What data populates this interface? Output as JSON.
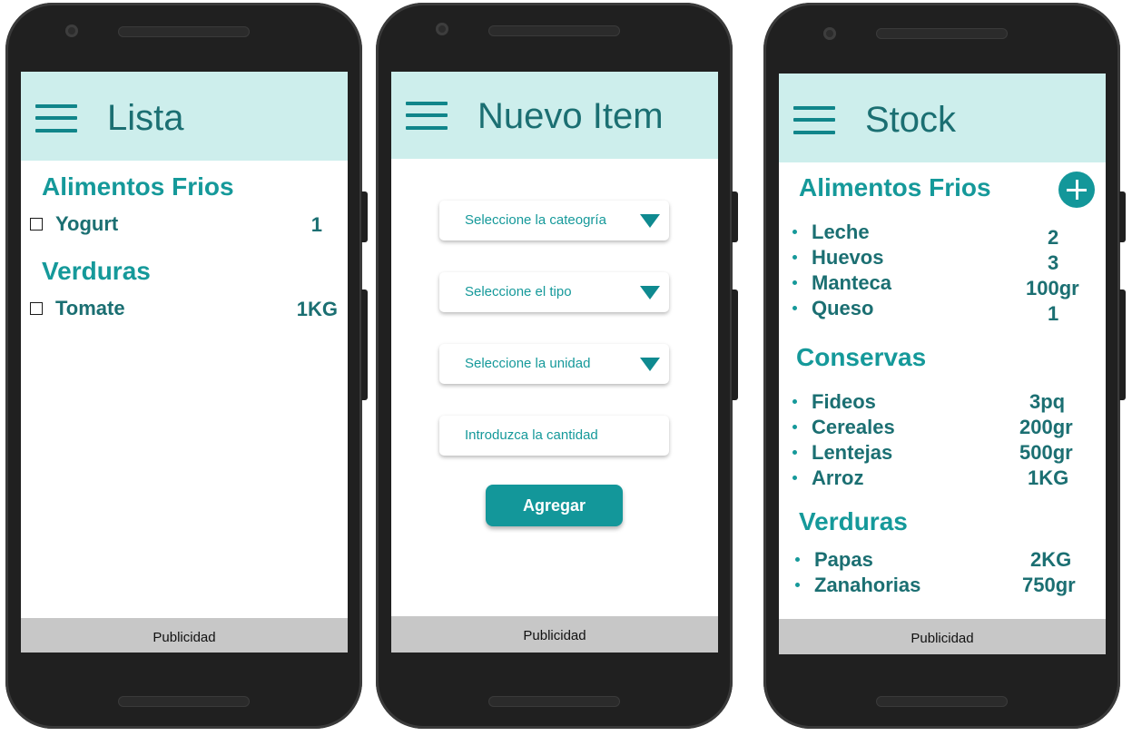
{
  "colors": {
    "appbar": "#cdeeec",
    "accent": "#15999a",
    "text_dark_teal": "#1b6f72",
    "ad_bar": "#c7c7c7"
  },
  "screens": [
    {
      "title": "Lista",
      "sections": [
        {
          "title": "Alimentos Frios",
          "items": [
            {
              "name": "Yogurt",
              "qty": "1"
            }
          ]
        },
        {
          "title": "Verduras",
          "items": [
            {
              "name": "Tomate",
              "qty": "1KG"
            }
          ]
        }
      ],
      "ad": "Publicidad"
    },
    {
      "title": "Nuevo Item",
      "fields": [
        {
          "placeholder": "Seleccione la cateogría",
          "type": "select"
        },
        {
          "placeholder": "Seleccione el tipo",
          "type": "select"
        },
        {
          "placeholder": "Seleccione la unidad",
          "type": "select"
        },
        {
          "placeholder": "Introduzca la cantidad",
          "type": "input"
        }
      ],
      "button": "Agregar",
      "ad": "Publicidad"
    },
    {
      "title": "Stock",
      "sections": [
        {
          "title": "Alimentos Frios",
          "items": [
            {
              "name": "Leche",
              "qty": "2"
            },
            {
              "name": "Huevos",
              "qty": "3"
            },
            {
              "name": "Manteca",
              "qty": "100gr"
            },
            {
              "name": "Queso",
              "qty": "1"
            }
          ]
        },
        {
          "title": "Conservas",
          "items": [
            {
              "name": "Fideos",
              "qty": "3pq"
            },
            {
              "name": "Cereales",
              "qty": "200gr"
            },
            {
              "name": "Lentejas",
              "qty": "500gr"
            },
            {
              "name": "Arroz",
              "qty": "1KG"
            }
          ]
        },
        {
          "title": "Verduras",
          "items": [
            {
              "name": "Papas",
              "qty": "2KG"
            },
            {
              "name": "Zanahorias",
              "qty": "750gr"
            }
          ]
        }
      ],
      "fab_icon": "plus-icon",
      "ad": "Publicidad"
    }
  ]
}
